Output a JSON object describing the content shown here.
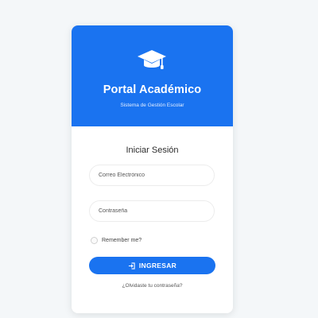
{
  "header": {
    "title": "Portal Académico",
    "subtitle": "Sistema de Gestión Escolar",
    "icon": "graduation-cap-icon",
    "color": "#1a73f0"
  },
  "form": {
    "title": "Iniciar Sesión",
    "email_placeholder": "Correo Electrónico",
    "password_placeholder": "Contraseña",
    "remember_label": "Remember me?",
    "remember_checked": false,
    "submit_label": "INGRESAR",
    "submit_icon": "sign-in-icon",
    "forgot_link": "¿Olvidaste tu contraseña?"
  }
}
